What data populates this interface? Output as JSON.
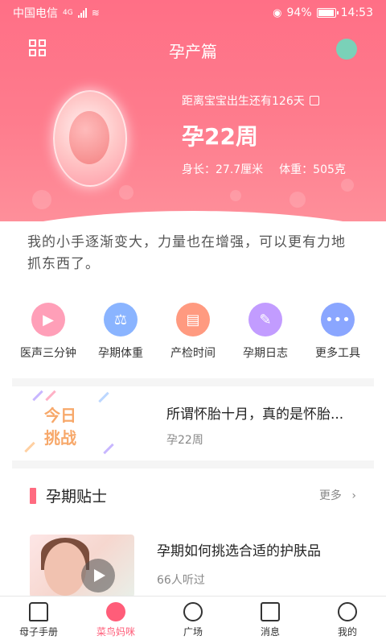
{
  "status": {
    "carrier": "中国电信",
    "network": "4G",
    "battery": "94%",
    "time": "14:53"
  },
  "header": {
    "title": "孕产篇",
    "countdown": "距离宝宝出生还有126天",
    "week": "孕22周",
    "length": "身长：27.7厘米",
    "weight": "体重：505克"
  },
  "message": "我的小手逐渐变大，力量也在增强，可以更有力地抓东西了。",
  "tools": [
    {
      "label": "医声三分钟",
      "icon": "video-icon",
      "color": "#ff9fb8"
    },
    {
      "label": "孕期体重",
      "icon": "scale-icon",
      "color": "#8ab4ff"
    },
    {
      "label": "产检时间",
      "icon": "calendar-icon",
      "color": "#ff9a80"
    },
    {
      "label": "孕期日志",
      "icon": "pen-icon",
      "color": "#c29cff"
    },
    {
      "label": "更多工具",
      "icon": "more-icon",
      "color": "#8aa6ff"
    }
  ],
  "challenge": {
    "badge_line1": "今日",
    "badge_line2": "挑战",
    "title": "所谓怀胎十月，真的是怀胎...",
    "sub": "孕22周"
  },
  "tips": {
    "title": "孕期贴士",
    "more": "更多",
    "article_title": "孕期如何挑选合适的护肤品",
    "article_sub": "66人听过"
  },
  "nav": [
    {
      "label": "母子手册",
      "icon": "home-icon",
      "active": false
    },
    {
      "label": "菜鸟妈咪",
      "icon": "heart-icon",
      "active": true
    },
    {
      "label": "广场",
      "icon": "compass-icon",
      "active": false
    },
    {
      "label": "消息",
      "icon": "message-icon",
      "active": false
    },
    {
      "label": "我的",
      "icon": "profile-icon",
      "active": false
    }
  ],
  "colors": {
    "accent": "#ff5d79",
    "header_top": "#ff6f86"
  }
}
